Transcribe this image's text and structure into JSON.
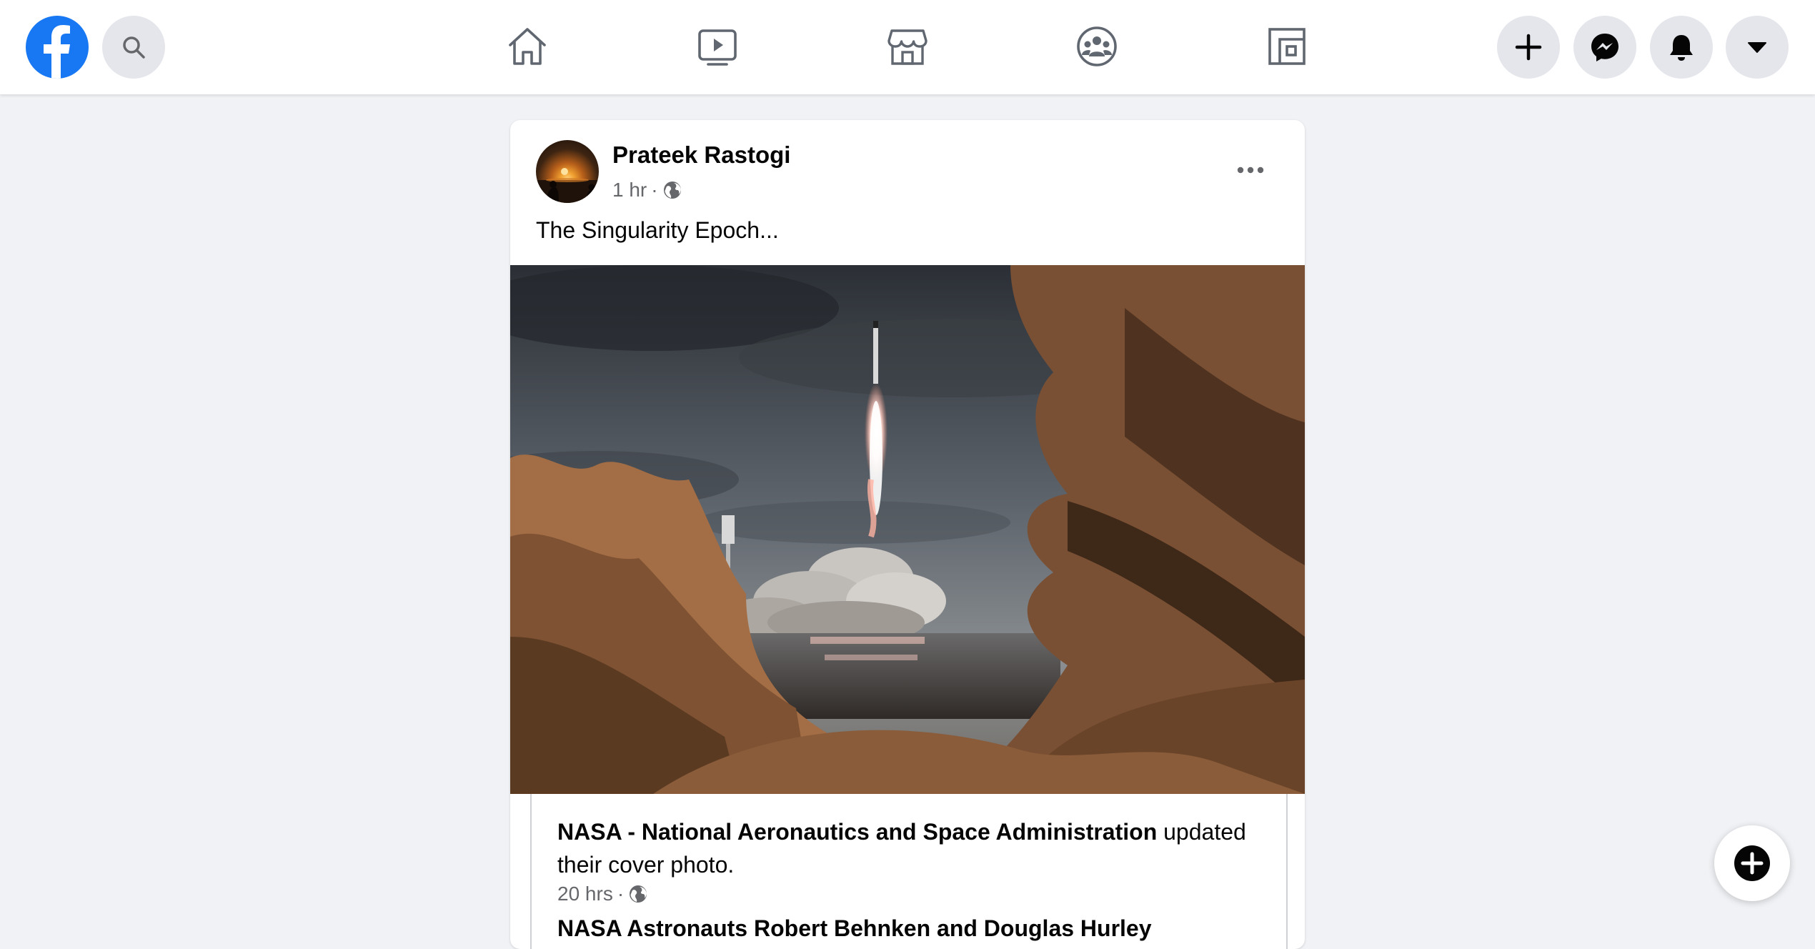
{
  "post": {
    "author": "Prateek Rastogi",
    "time": "1 hr",
    "separator": "·",
    "text": "The Singularity Epoch...",
    "shared": {
      "page_name": "NASA - National Aeronautics and Space Administration",
      "action": " updated their cover photo.",
      "time": "20 hrs",
      "separator": "·",
      "next_line": "NASA Astronauts Robert Behnken and Douglas Hurley"
    }
  },
  "colors": {
    "brand": "#1877f2",
    "background": "#f0f2f5",
    "button_gray": "#e4e6eb",
    "secondary_text": "#65676b",
    "icon_gray": "#606770"
  },
  "icons": {
    "logo": "facebook-logo",
    "search": "search-icon",
    "nav": [
      "home-icon",
      "watch-icon",
      "marketplace-icon",
      "groups-icon",
      "gaming-icon"
    ],
    "right": [
      "create-plus-icon",
      "messenger-icon",
      "notifications-bell-icon",
      "account-caret-icon"
    ],
    "privacy": "globe-icon",
    "more": "more-options-icon",
    "compose": "new-message-icon"
  }
}
